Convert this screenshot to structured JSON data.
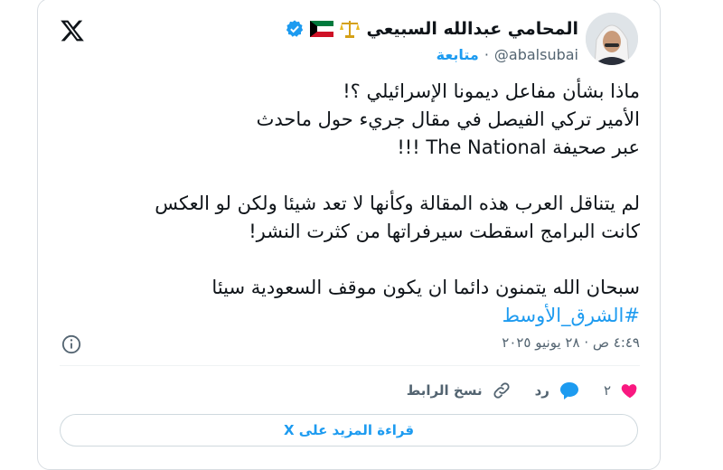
{
  "author": {
    "name": "المحامي عبدالله السبيعي",
    "handle": "@abalsubai",
    "follow_label": "متابعة"
  },
  "tweet": {
    "lines_block1": [
      "ماذا بشأن مفاعل ديمونا الإسرائيلي ؟!",
      "الأمير تركي الفيصل في مقال جريء حول ماحدث",
      "عبر صحيفة The National !!!"
    ],
    "lines_block2": [
      "لم يتناقل العرب هذه المقالة وكأنها لا تعد شيئا ولكن لو العكس",
      "كانت البرامج اسقطت سيرفراتها من كثرت النشر!"
    ],
    "lines_block3": [
      "سبحان الله يتمنون دائما ان يكون موقف السعودية سيئا"
    ],
    "hashtag": "#الشرق_الأوسط",
    "timestamp": "٤:٤٩ ص · ٢٨ يونيو ٢٠٢٥"
  },
  "actions": {
    "likes_count": "٢",
    "reply_label": "رد",
    "copy_link_label": "نسخ الرابط"
  },
  "read_more_label": "قراءة المزيد على X",
  "colors": {
    "accent": "#1d9bf0",
    "like": "#f91880",
    "verified": "#1d9bf0",
    "muted": "#536471"
  },
  "icons": [
    "x-logo-icon",
    "verified-badge-icon",
    "kuwait-flag-icon",
    "scales-emoji-icon",
    "info-icon",
    "heart-icon",
    "reply-bubble-icon",
    "link-icon"
  ]
}
